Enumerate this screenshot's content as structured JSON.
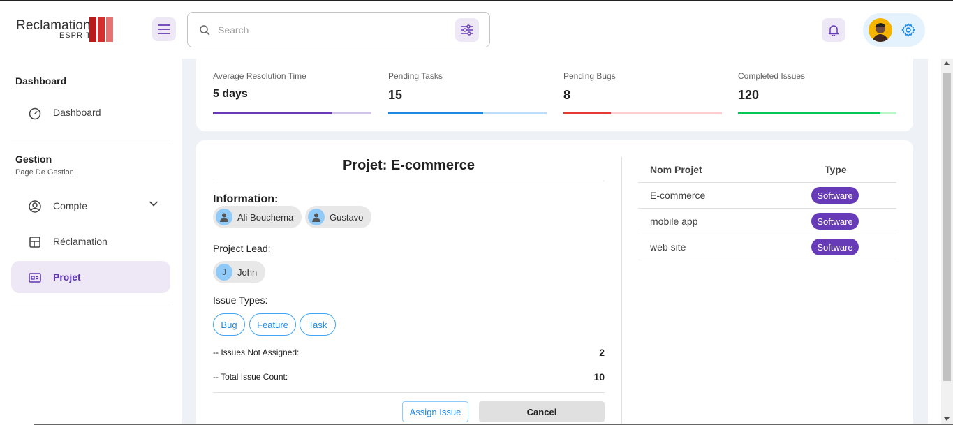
{
  "header": {
    "logo_main": "Reclamation",
    "logo_sub": "ESPRIT",
    "logo_colors": [
      "#b71c1c",
      "#d32f2f",
      "#e57373"
    ],
    "search_placeholder": "Search",
    "icons": [
      "menu-icon",
      "search-icon",
      "filter-icon",
      "bell-icon",
      "avatar",
      "gear-icon"
    ]
  },
  "sidebar": {
    "section1_title": "Dashboard",
    "dashboard_item": "Dashboard",
    "section2_title": "Gestion",
    "section2_caption": "Page De Gestion",
    "items": [
      {
        "label": "Compte",
        "icon": "user-circle-icon"
      },
      {
        "label": "Réclamation",
        "icon": "layout-icon"
      },
      {
        "label": "Projet",
        "icon": "id-card-icon"
      }
    ]
  },
  "stats": [
    {
      "label": "Average Resolution Time",
      "value": "5 days",
      "fraction": 0.75,
      "color": "#673ab7",
      "track": "#d1c4e9"
    },
    {
      "label": "Pending Tasks",
      "value": "15",
      "fraction": 0.6,
      "color": "#1e88e5",
      "track": "#bbdefb"
    },
    {
      "label": "Pending Bugs",
      "value": "8",
      "fraction": 0.3,
      "color": "#e53935",
      "track": "#ffcdd2"
    },
    {
      "label": "Completed Issues",
      "value": "120",
      "fraction": 0.9,
      "color": "#00c853",
      "track": "#b9f6ca"
    }
  ],
  "project": {
    "title": "Projet: E-commerce",
    "information_label": "Information:",
    "members": [
      "Ali Bouchema",
      "Gustavo"
    ],
    "lead_label": "Project Lead:",
    "lead_initial": "J",
    "lead_name": "John",
    "issue_types_label": "Issue Types:",
    "issue_types": [
      "Bug",
      "Feature",
      "Task"
    ],
    "not_assigned_label": "-- Issues Not Assigned:",
    "not_assigned_value": "2",
    "total_label": "-- Total Issue Count:",
    "total_value": "10",
    "assign_button": "Assign Issue",
    "cancel_button": "Cancel"
  },
  "table": {
    "col_name": "Nom Projet",
    "col_type": "Type",
    "rows": [
      {
        "name": "E-commerce",
        "type": "Software"
      },
      {
        "name": "mobile app",
        "type": "Software"
      },
      {
        "name": "web site",
        "type": "Software"
      }
    ]
  }
}
